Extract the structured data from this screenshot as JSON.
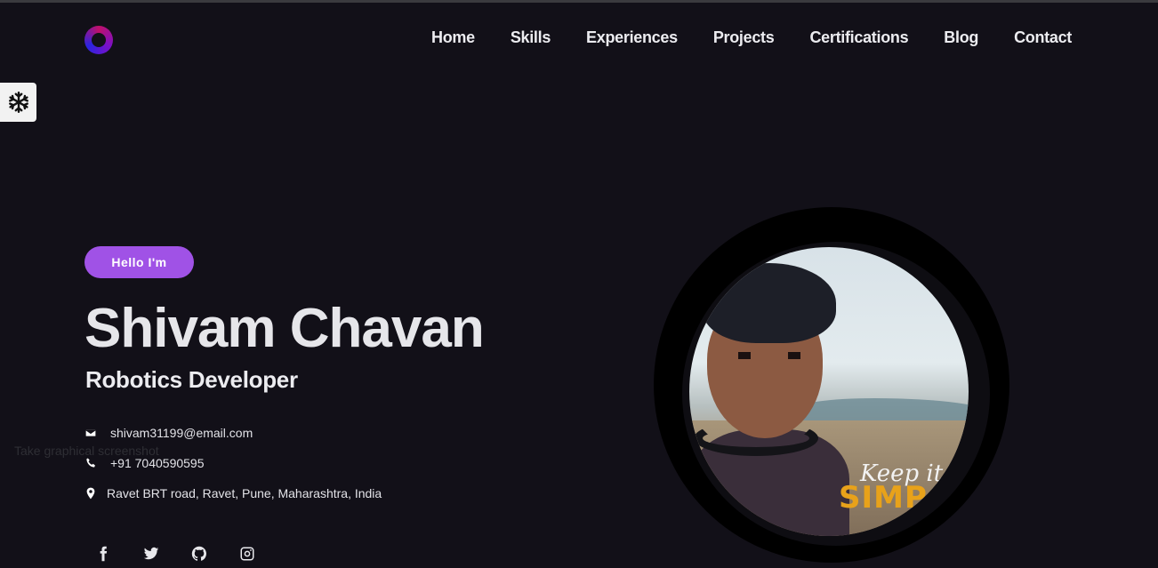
{
  "nav": {
    "items": [
      {
        "label": "Home"
      },
      {
        "label": "Skills"
      },
      {
        "label": "Experiences"
      },
      {
        "label": "Projects"
      },
      {
        "label": "Certifications"
      },
      {
        "label": "Blog"
      },
      {
        "label": "Contact"
      }
    ]
  },
  "hero": {
    "greeting": "Hello I'm",
    "name": "Shivam Chavan",
    "role": "Robotics Developer",
    "email": "shivam31199@email.com",
    "phone": "+91 7040590595",
    "address": "Ravet BRT road, Ravet, Pune, Maharashtra, India"
  },
  "overlay": {
    "tooltip": "Take graphical screenshot"
  },
  "avatar": {
    "caption_line1": "Keep it",
    "caption_line2": "SIMP"
  },
  "icons": {
    "logo": "logo-icon",
    "settings": "snowflake-icon",
    "email": "envelope-icon",
    "phone": "phone-icon",
    "address": "map-marker-icon",
    "socials": [
      "facebook-icon",
      "twitter-icon",
      "github-icon",
      "instagram-icon"
    ]
  },
  "colors": {
    "background": "#121018",
    "accent": "#a052e6",
    "text": "#e9e9ee"
  }
}
